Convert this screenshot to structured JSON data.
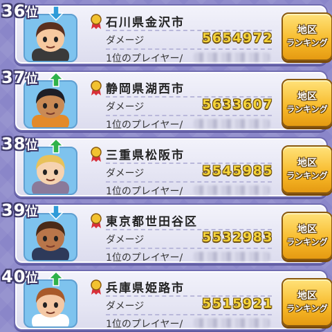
{
  "rankings": [
    {
      "rank": "36",
      "rank_suffix": "位",
      "trend": "down",
      "city": "石川県金沢市",
      "damage_label": "ダメージ",
      "damage": "5654972",
      "player_label": "1位のプレイヤー/",
      "button_line1": "地区",
      "button_line2": "ランキング",
      "skin": "#f6c9a0",
      "hair": "#5a3020",
      "shirt": "#3a3a3a"
    },
    {
      "rank": "37",
      "rank_suffix": "位",
      "trend": "up",
      "city": "静岡県湖西市",
      "damage_label": "ダメージ",
      "damage": "5633607",
      "player_label": "1位のプレイヤー/",
      "button_line1": "地区",
      "button_line2": "ランキング",
      "skin": "#c98a55",
      "hair": "#1e1e26",
      "shirt": "#e38a2a"
    },
    {
      "rank": "38",
      "rank_suffix": "位",
      "trend": "up",
      "city": "三重県松阪市",
      "damage_label": "ダメージ",
      "damage": "5545985",
      "player_label": "1位のプレイヤー/",
      "button_line1": "地区",
      "button_line2": "ランキング",
      "skin": "#f6d3b0",
      "hair": "#e8c25a",
      "shirt": "#8a7a9a"
    },
    {
      "rank": "39",
      "rank_suffix": "位",
      "trend": "down",
      "city": "東京都世田谷区",
      "damage_label": "ダメージ",
      "damage": "5532983",
      "player_label": "1位のプレイヤー/",
      "button_line1": "地区",
      "button_line2": "ランキング",
      "skin": "#b9764a",
      "hair": "#4a2a18",
      "shirt": "#2e3a5a"
    },
    {
      "rank": "40",
      "rank_suffix": "位",
      "trend": "up",
      "city": "兵庫県姫路市",
      "damage_label": "ダメージ",
      "damage": "5515921",
      "player_label": "1位のプレイヤー/",
      "button_line1": "地区",
      "button_line2": "ランキング",
      "skin": "#f4c8a4",
      "hair": "#a85a2a",
      "shirt": "#ffffff"
    }
  ],
  "colors": {
    "up_arrow": "#2fb24a",
    "down_arrow": "#2f9bd8",
    "medal_ribbon": "#d8303a",
    "medal_gold": "#f2c230"
  }
}
